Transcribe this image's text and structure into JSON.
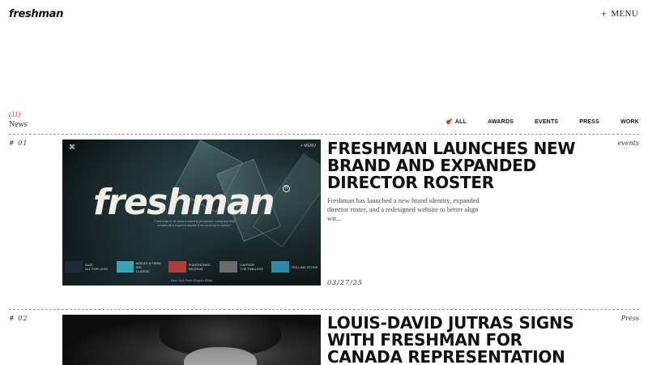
{
  "header": {
    "logo": "freshman",
    "menu_label": "MENU",
    "menu_icon": "plus-icon"
  },
  "news": {
    "count": "(11)",
    "label": "News",
    "filters": [
      {
        "label": "ALL",
        "active": true
      },
      {
        "label": "AWARDS",
        "active": false
      },
      {
        "label": "EVENTS",
        "active": false
      },
      {
        "label": "PRESS",
        "active": false
      },
      {
        "label": "WORK",
        "active": false
      }
    ]
  },
  "articles": [
    {
      "number": "# 01",
      "category": "events",
      "title": "FRESHMAN LAUNCHES NEW BRAND AND EXPANDED DIRECTOR ROSTER",
      "summary": "Freshman has launched a new brand identity, expanded director roster, and a redesigned website to better align wit...",
      "date": "03/27/25",
      "thumbnail": {
        "wordmark": "freshman",
        "registered": "R",
        "menu": "+ MENU",
        "tagline": "Freshman is an award-winning production company that creates film-inspired stories from concept to screen.",
        "strip": [
          {
            "title": "AUDI",
            "sub": "ALL FOR LESS"
          },
          {
            "title": "ADIDAS & FARM RIO",
            "sub": "CLASSIC"
          },
          {
            "title": "POKERSTARS",
            "sub": "REGRAM"
          },
          {
            "title": "CARTIER",
            "sub": "THE TIMELESS"
          },
          {
            "title": "ROLLING STONE",
            "sub": ""
          }
        ],
        "footer": "New York  Paris  Bogota  Milan"
      }
    },
    {
      "number": "# 02",
      "category": "Press",
      "title": "LOUIS-DAVID JUTRAS SIGNS WITH FRESHMAN FOR CANADA REPRESENTATION"
    }
  ],
  "colors": {
    "accent": "#e0332a",
    "text": "#111111",
    "muted": "#444444"
  }
}
